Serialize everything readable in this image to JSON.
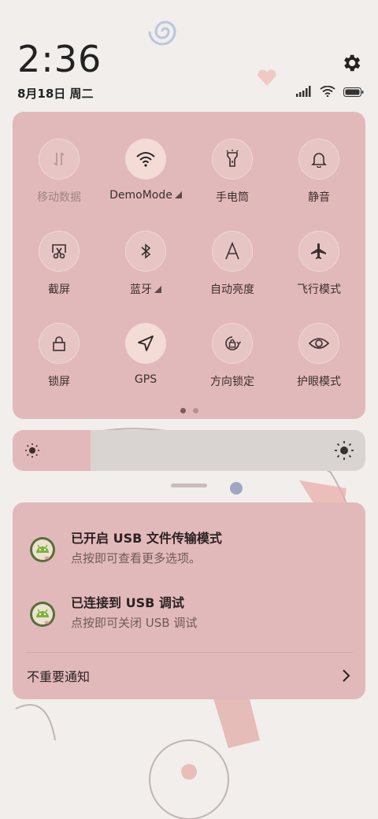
{
  "status": {
    "time": "2:36",
    "date": "8月18日 周二"
  },
  "quick_settings": {
    "tiles": [
      {
        "label": "移动数据",
        "icon": "mobile-data-icon",
        "state": "disabled"
      },
      {
        "label": "DemoMode",
        "icon": "wifi-icon",
        "state": "active",
        "has_dropdown": true
      },
      {
        "label": "手电筒",
        "icon": "flashlight-icon",
        "state": "off"
      },
      {
        "label": "静音",
        "icon": "bell-icon",
        "state": "off"
      },
      {
        "label": "截屏",
        "icon": "screenshot-icon",
        "state": "off"
      },
      {
        "label": "蓝牙",
        "icon": "bluetooth-icon",
        "state": "off",
        "has_dropdown": true
      },
      {
        "label": "自动亮度",
        "icon": "auto-brightness-icon",
        "state": "off"
      },
      {
        "label": "飞行模式",
        "icon": "airplane-icon",
        "state": "off"
      },
      {
        "label": "锁屏",
        "icon": "lock-icon",
        "state": "off"
      },
      {
        "label": "GPS",
        "icon": "location-arrow-icon",
        "state": "active"
      },
      {
        "label": "方向锁定",
        "icon": "rotation-lock-icon",
        "state": "off"
      },
      {
        "label": "护眼模式",
        "icon": "eye-icon",
        "state": "off"
      }
    ],
    "page_count": 2,
    "current_page": 1
  },
  "brightness": {
    "level": 0.22
  },
  "notifications": [
    {
      "title": "已开启 USB 文件传输模式",
      "subtitle": "点按即可查看更多选项。",
      "icon": "android-usb-icon"
    },
    {
      "title": "已连接到 USB 调试",
      "subtitle": "点按即可关闭 USB 调试",
      "icon": "android-usb-icon"
    }
  ],
  "unimportant_label": "不重要通知",
  "colors": {
    "panel": "#e2b9ba",
    "background": "#f1eeeb",
    "active_tile": "#f4dcd6"
  }
}
